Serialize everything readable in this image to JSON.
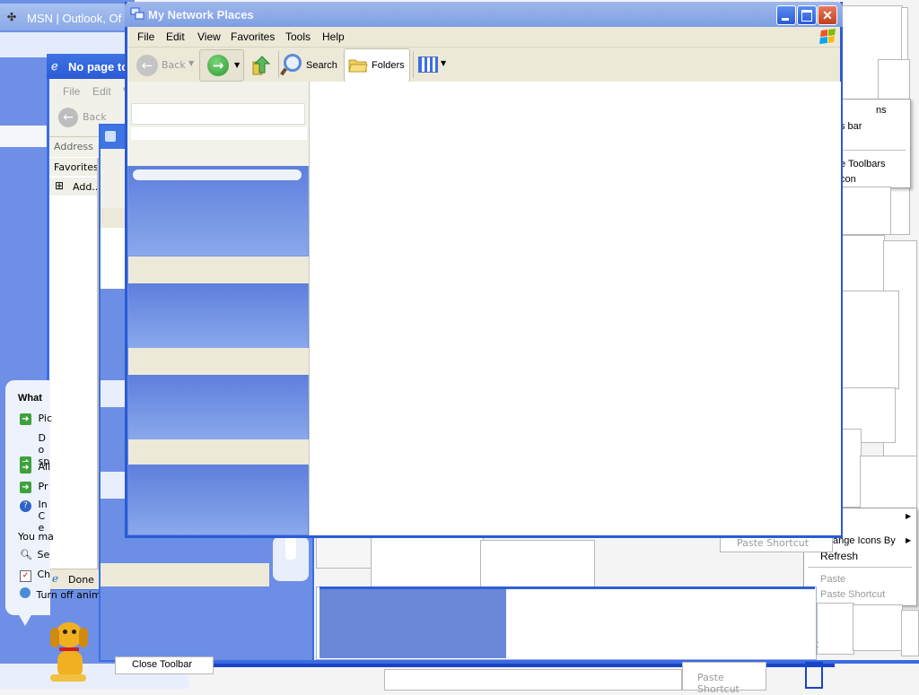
{
  "msn_window": {
    "title": "MSN | Outlook, Of"
  },
  "ie_window": {
    "title": "No page to",
    "menu": [
      "File",
      "Edit",
      "Vi"
    ],
    "back_label": "Back",
    "address_label": "Address",
    "favorites_label": "Favorites",
    "add_label": "Add...",
    "status": "Done"
  },
  "search_panel": {
    "heading": "What",
    "items": [
      "Pic",
      "Do sp",
      "All",
      "Pr",
      "In Ce"
    ],
    "you_may": "You ma",
    "extra_items": [
      "Se",
      "Ch"
    ],
    "turn_off": "Turn off anima"
  },
  "main_window": {
    "title": "My Network Places",
    "menu": [
      "File",
      "Edit",
      "View",
      "Favorites",
      "Tools",
      "Help"
    ],
    "toolbar": {
      "back": "Back",
      "search": "Search",
      "folders": "Folders"
    }
  },
  "right_menus": {
    "fragment_1": "ns",
    "fragment_2": "s bar",
    "toolbars_item": "e Toolbars",
    "icon_item": "con",
    "paste_shortcut_ghost": "Paste Shortcut",
    "arrange_icons": "ange Icons By",
    "refresh": "Refresh",
    "paste": "Paste",
    "paste_shortcut": "Paste Shortcut",
    "t_fragment": "t",
    "paste_shortcut_bottom": "Paste Shortcut"
  },
  "close_toolbar": "Close Toolbar",
  "colors": {
    "xp_blue": "#0a4ccf",
    "pane_blue": "#6a8ee2",
    "menu_bg": "#ece9d8"
  }
}
